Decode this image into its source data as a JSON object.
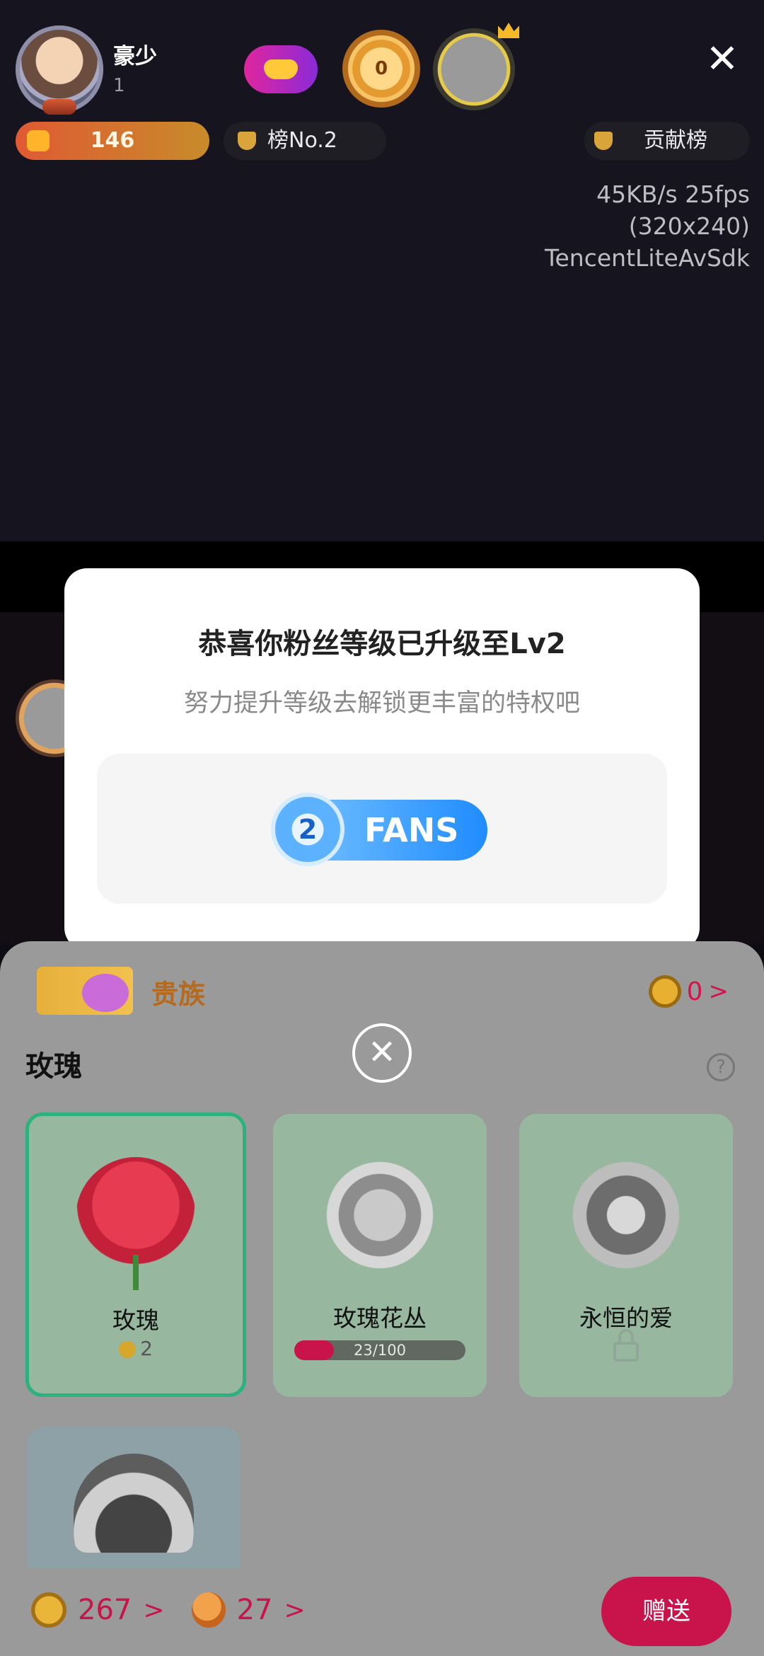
{
  "header": {
    "streamer_name": "豪少",
    "streamer_sub": "1",
    "medal_value": "0",
    "gold_count": "146",
    "rank_label": "榜No.2",
    "contribution_label": "贡献榜"
  },
  "stats": {
    "bitrate": "45KB/s 25fps",
    "resolution": "(320x240)",
    "sdk": "TencentLiteAvSdk"
  },
  "dialog": {
    "title": "恭喜你粉丝等级已升级至Lv2",
    "subtitle": "努力提升等级去解锁更丰富的特权吧",
    "badge_level": "2",
    "badge_text": "FANS"
  },
  "sheet": {
    "banner_title": "贵族",
    "balance": "0",
    "balance_chevron": ">",
    "section_title": "玫瑰",
    "help": "?",
    "close": "✕",
    "gifts": [
      {
        "name": "玫瑰",
        "price": "2",
        "selected": true
      },
      {
        "name": "玫瑰花丛",
        "progress_label": "23/100",
        "progress": 0.23
      },
      {
        "name": "永恒的爱",
        "locked": true
      },
      {
        "name": ""
      }
    ],
    "coins": "267",
    "beans": "27",
    "chevron": ">",
    "send_label": "赠送"
  },
  "colors": {
    "accent": "#c8134b",
    "selected_border": "#2db17e",
    "fans_blue": "#1f8cff"
  },
  "icons": [
    "close-icon",
    "trophy-icon",
    "coin-icon",
    "bean-icon",
    "lock-icon",
    "help-icon",
    "crown-icon",
    "heart-icon"
  ]
}
